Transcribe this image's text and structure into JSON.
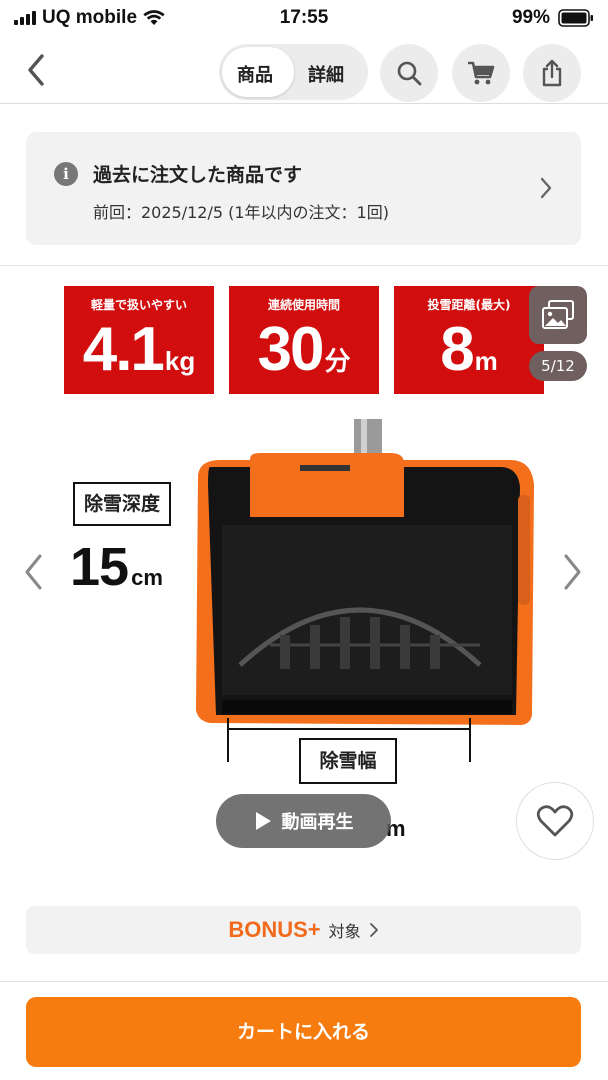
{
  "status_bar": {
    "carrier": "UQ mobile",
    "time": "17:55",
    "battery": "99%"
  },
  "header": {
    "tabs": [
      {
        "label": "商品",
        "active": true
      },
      {
        "label": "詳細",
        "active": false
      }
    ],
    "icons": [
      "back-icon",
      "search-icon",
      "cart-icon",
      "share-icon"
    ]
  },
  "notice": {
    "title": "過去に注文した商品です",
    "subtitle": "前回：2025/12/5 (1年以内の注文：1回)"
  },
  "product_image": {
    "specs": [
      {
        "label": "軽量で扱いやすい",
        "value": "4.1",
        "unit": "kg"
      },
      {
        "label": "連続使用時間",
        "value": "30",
        "unit": "分"
      },
      {
        "label": "投雪距離(最大)",
        "value": "8",
        "unit": "m"
      }
    ],
    "depth_label": "除雪深度",
    "depth_value": "15",
    "depth_unit": "cm",
    "width_label": "除雪幅",
    "width_unit": "m",
    "counter": "5/12",
    "video_label": "動画再生",
    "colors": {
      "accent_red": "#d20d0d",
      "product_orange": "#f36f1c"
    }
  },
  "bonus": {
    "brand": "BONUS+",
    "target": "対象"
  },
  "cart_button": {
    "label": "カートに入れる",
    "color": "#f77c0f"
  }
}
